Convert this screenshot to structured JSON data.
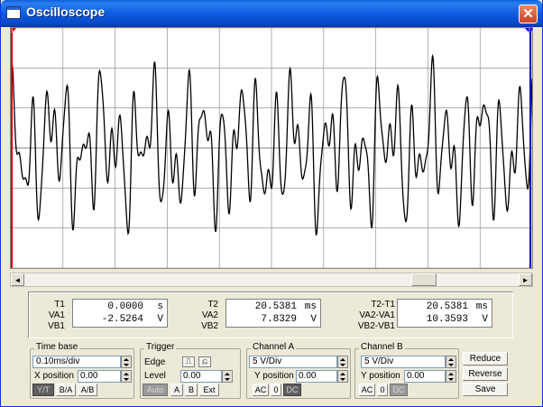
{
  "window": {
    "title": "Oscilloscope",
    "close_label": "✕"
  },
  "colors": {
    "trace": "#000000",
    "grid": "#808080",
    "cursor1": "#cc0000",
    "cursor2": "#0000cc",
    "title_bar": "#0a5ed9"
  },
  "cursors": {
    "t1_label": "1",
    "t2_label": "2"
  },
  "scrollbar": {
    "left_label": "◄",
    "right_label": "►"
  },
  "readout": {
    "col1": {
      "labels": [
        "T1",
        "VA1",
        "VB1"
      ],
      "values": [
        {
          "v": "0.0000",
          "u": "s"
        },
        {
          "v": "-2.5264",
          "u": "V"
        }
      ]
    },
    "col2": {
      "labels": [
        "T2",
        "VA2",
        "VB2"
      ],
      "values": [
        {
          "v": "20.5381",
          "u": "ms"
        },
        {
          "v": "7.8329",
          "u": "V"
        }
      ]
    },
    "col3": {
      "labels": [
        "T2-T1",
        "VA2-VA1",
        "VB2-VB1"
      ],
      "values": [
        {
          "v": "20.5381",
          "u": "ms"
        },
        {
          "v": "10.3593",
          "u": "V"
        }
      ]
    }
  },
  "timebase": {
    "title": "Time base",
    "value": "0.10ms/div",
    "xpos_label": "X position",
    "xpos_value": "0.00",
    "modes": [
      "Y/T",
      "B/A",
      "A/B"
    ]
  },
  "trigger": {
    "title": "Trigger",
    "edge_label": "Edge",
    "level_label": "Level",
    "level_value": "0.00",
    "modes": [
      "Auto",
      "A",
      "B",
      "Ext"
    ]
  },
  "channel_a": {
    "title": "Channel A",
    "value": "5 V/Div",
    "ypos_label": "Y position",
    "ypos_value": "0.00",
    "coupling": [
      "AC",
      "0",
      "DC"
    ]
  },
  "channel_b": {
    "title": "Channel B",
    "value": "5 V/Div",
    "ypos_label": "Y position",
    "ypos_value": "0.00",
    "coupling": [
      "AC",
      "0",
      "DC"
    ]
  },
  "actions": {
    "reduce": "Reduce",
    "reverse": "Reverse",
    "save": "Save"
  }
}
